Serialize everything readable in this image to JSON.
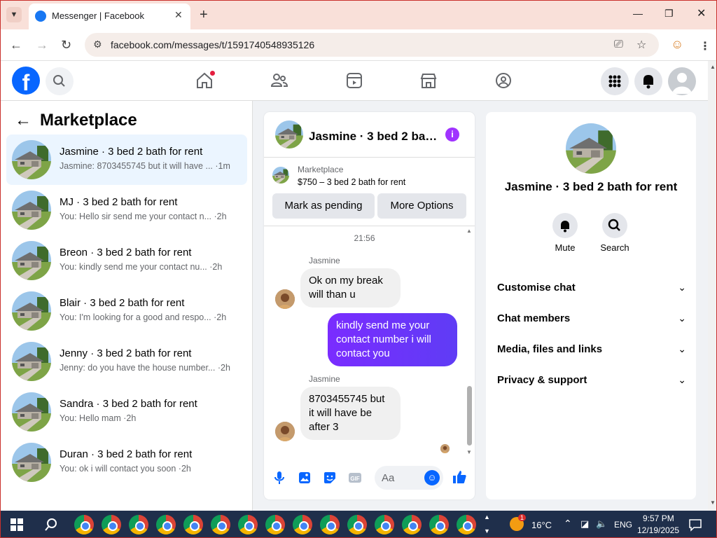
{
  "browser": {
    "tab_title": "Messenger | Facebook",
    "url": "facebook.com/messages/t/1591740548935126"
  },
  "sidebar": {
    "title": "Marketplace",
    "conversations": [
      {
        "name": "Jasmine · 3 bed 2 bath for rent",
        "preview": "Jasmine: 8703455745 but it will have ... ·1m",
        "active": true
      },
      {
        "name": "MJ · 3 bed 2 bath for rent",
        "preview": "You: Hello sir send me your contact n... ·2h"
      },
      {
        "name": "Breon · 3 bed 2 bath for rent",
        "preview": "You: kindly send me your contact nu... ·2h"
      },
      {
        "name": "Blair · 3 bed 2 bath for rent",
        "preview": "You: I'm looking for a good and respo... ·2h"
      },
      {
        "name": "Jenny · 3 bed 2 bath for rent",
        "preview": "Jenny: do you have the house number... ·2h"
      },
      {
        "name": "Sandra · 3 bed 2 bath for rent",
        "preview": "You: Hello mam ·2h"
      },
      {
        "name": "Duran · 3 bed 2 bath for rent",
        "preview": "You: ok i will contact you soon ·2h"
      }
    ]
  },
  "chat": {
    "title": "Jasmine · 3 bed 2 bath for rent",
    "marketplace_label": "Marketplace",
    "listing": "$750 – 3 bed 2 bath for rent",
    "mark_pending": "Mark as pending",
    "more_options": "More Options",
    "timestamp": "21:56",
    "sender1": "Jasmine",
    "msg1": "Ok on my break will than u",
    "msg2": "kindly send me your contact number i will contact you",
    "sender2": "Jasmine",
    "msg3": "8703455745 but it will have be after 3",
    "input_placeholder": "Aa"
  },
  "details": {
    "name": "Jasmine · 3 bed 2 bath for rent",
    "mute": "Mute",
    "search": "Search",
    "sections": [
      "Customise chat",
      "Chat members",
      "Media, files and links",
      "Privacy & support"
    ]
  },
  "taskbar": {
    "weather": "16°C",
    "lang": "ENG",
    "time": "9:57 PM",
    "date": "12/19/2025",
    "weather_badge": "1"
  }
}
